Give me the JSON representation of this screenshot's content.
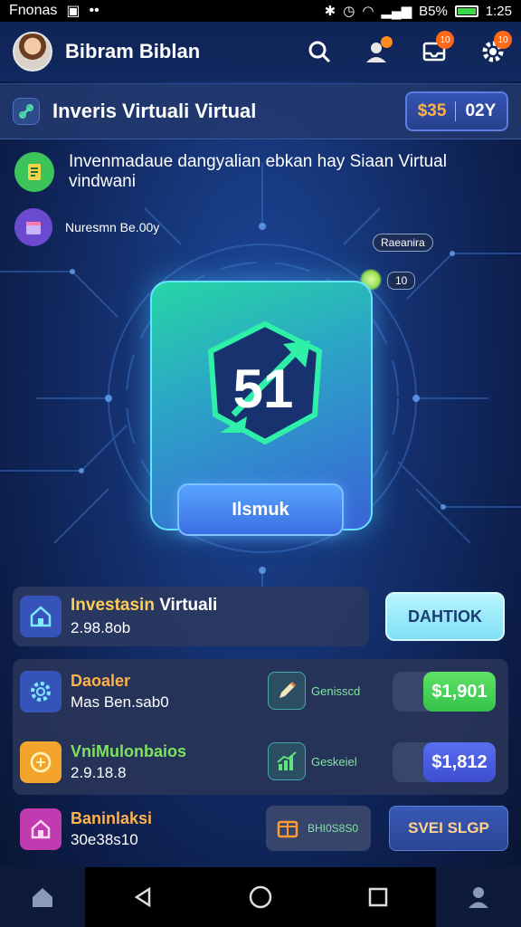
{
  "status_bar": {
    "app_label": "Fnonas",
    "battery": "B5%",
    "time": "1:25"
  },
  "header": {
    "user_name": "Bibram Biblan",
    "notif_badge_1": "10",
    "notif_badge_2": "10"
  },
  "title_bar": {
    "title": "Inveris Virtuali Virtual",
    "stat_value": "$35",
    "stat_label": "02Y"
  },
  "info": {
    "headline": "Invenmadaue dangyalian ebkan hay Siaan Virtual vindwani",
    "sub": "Nuresmn Be.00y",
    "chip_1": "Raeanira",
    "chip_2": "10"
  },
  "hero": {
    "logo_text": "51",
    "button_label": "Ilsmuk"
  },
  "invest": {
    "title_highlight": "Investasin",
    "title_rest": " Virtuali",
    "value": "2.98.8ob",
    "action_label": "DAHTIOK"
  },
  "stats": [
    {
      "title": "Daoaler",
      "value": "Mas Ben.sab0",
      "mini_label": "Genisscd",
      "button": "$1,901",
      "accent": "#f0a63a",
      "title_color": "#ffb24a"
    },
    {
      "title": "VniMulonbaios",
      "value": "2.9.18.8",
      "mini_label": "Geskeiel",
      "button": "$1,812",
      "accent": "#f0a63a",
      "title_color": "#7ee35f"
    }
  ],
  "bottom_row": {
    "title": "Baninlaksi",
    "value": "30e38s10",
    "mini_label": "BHI0S8S0",
    "button": "SVEI SLGP",
    "title_color": "#ffb24a"
  },
  "colors": {
    "accent_green": "#3dd64a",
    "accent_blue": "#3a63d8",
    "accent_cyan": "#7fe0f6",
    "accent_orange": "#ff8a1f"
  },
  "icons": [
    "home-icon",
    "back-icon",
    "home-circle-icon",
    "recents-icon",
    "profile-icon",
    "search-icon",
    "notification-icon",
    "inbox-icon",
    "settings-icon"
  ]
}
